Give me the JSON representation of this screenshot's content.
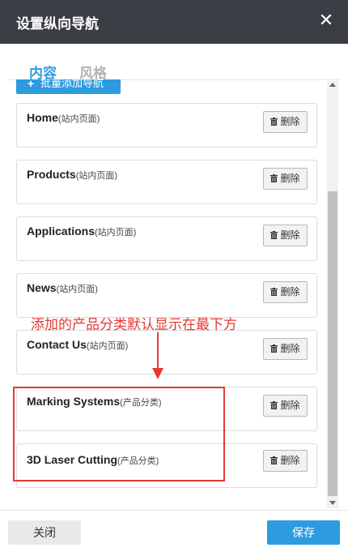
{
  "dialog": {
    "title": "设置纵向导航",
    "close_icon": "close-icon"
  },
  "tabs": [
    {
      "label": "内容",
      "active": true
    },
    {
      "label": "风格",
      "active": false
    }
  ],
  "toolbar": {
    "batch_add_label": "批量添加导航",
    "batch_add_icon": "plus-icon"
  },
  "nav_items": [
    {
      "name": "Home",
      "type": "(站内页面)",
      "delete_label": "删除"
    },
    {
      "name": "Products",
      "type": "(站内页面)",
      "delete_label": "删除"
    },
    {
      "name": "Applications",
      "type": "(站内页面)",
      "delete_label": "删除"
    },
    {
      "name": "News",
      "type": "(站内页面)",
      "delete_label": "删除"
    },
    {
      "name": "Contact Us",
      "type": "(站内页面)",
      "delete_label": "删除"
    },
    {
      "name": "Marking Systems",
      "type": "(产品分类)",
      "delete_label": "删除"
    },
    {
      "name": "3D Laser Cutting",
      "type": "(产品分类)",
      "delete_label": "删除"
    }
  ],
  "annotation": {
    "text": "添加的产品分类默认显示在最下方",
    "color": "#e53935"
  },
  "footer": {
    "close_label": "关闭",
    "save_label": "保存"
  },
  "colors": {
    "accent": "#2c9be0",
    "titlebar": "#3a3d43"
  }
}
